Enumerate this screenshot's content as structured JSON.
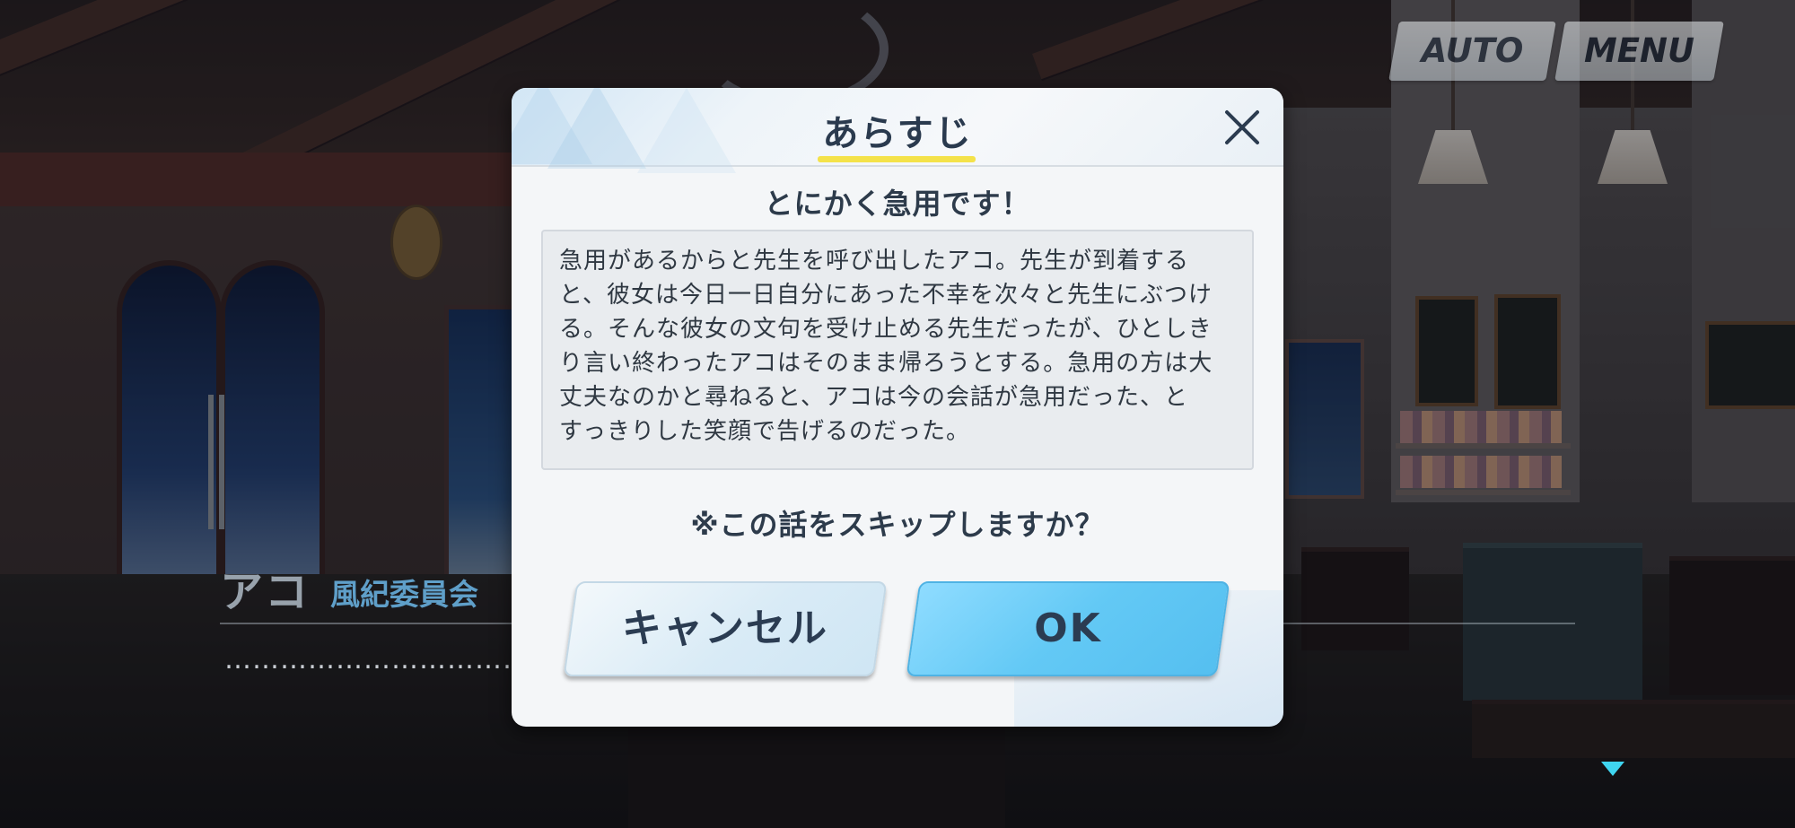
{
  "hud": {
    "auto_label": "AUTO",
    "menu_label": "MENU"
  },
  "dialogue": {
    "speaker_name": "アコ",
    "speaker_affiliation": "風紀委員会",
    "text": "……………………………………"
  },
  "modal": {
    "title": "あらすじ",
    "episode_title": "とにかく急用です！",
    "synopsis_lines": [
      "急用があるからと先生を呼び出したアコ。先生が到着する",
      "と、彼女は今日一日自分にあった不幸を次々と先生にぶつけ",
      "る。そんな彼女の文句を受け止める先生だったが、ひとしき",
      "り言い終わったアコはそのまま帰ろうとする。急用の方は大",
      "丈夫なのかと尋ねると、アコは今の会話が急用だった、と",
      "すっきりした笑顔で告げるのだった。"
    ],
    "question": "※この話をスキップしますか？",
    "cancel_label": "キャンセル",
    "ok_label": "OK"
  },
  "colors": {
    "accent_ok": "#63c9f5",
    "title_underline": "#f4e24a",
    "affiliation_text": "#5f9fc9",
    "next_arrow": "#3fd5f0"
  }
}
